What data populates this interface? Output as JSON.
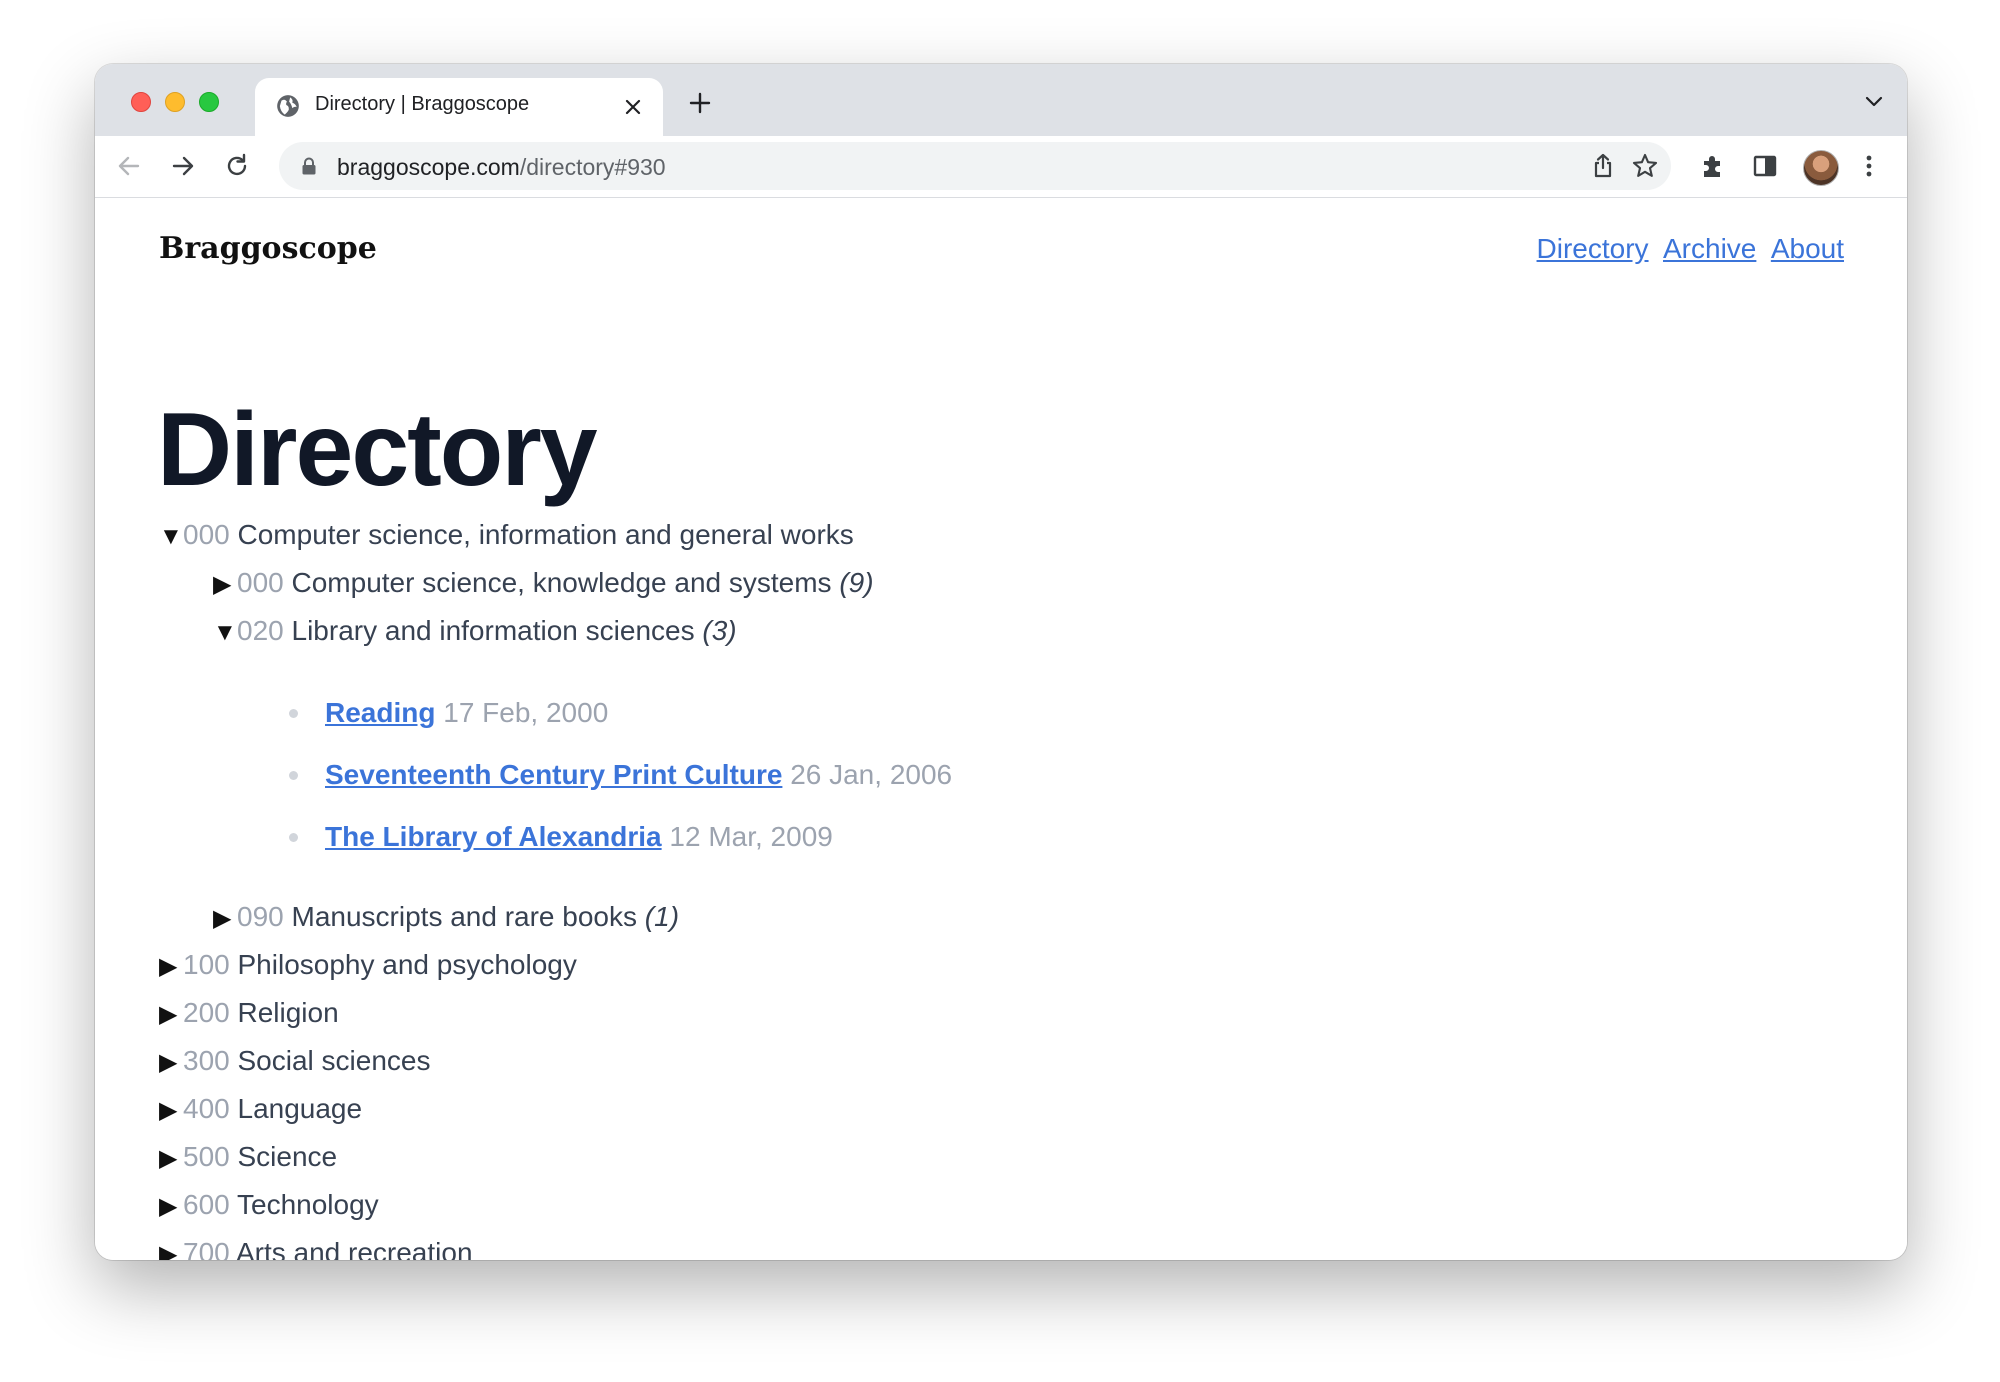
{
  "browser": {
    "tab_title": "Directory | Braggoscope",
    "url_host": "braggoscope.com",
    "url_path": "/directory#930"
  },
  "site": {
    "title": "Braggoscope",
    "nav": [
      "Directory",
      "Archive",
      "About"
    ]
  },
  "page": {
    "title": "Directory",
    "tree": [
      {
        "level": 0,
        "expanded": true,
        "code": "000",
        "label": "Computer science, information and general works",
        "count": ""
      },
      {
        "level": 1,
        "expanded": false,
        "code": "000",
        "label": "Computer science, knowledge and systems",
        "count": "(9)"
      },
      {
        "level": 1,
        "expanded": true,
        "code": "020",
        "label": "Library and information sciences",
        "count": "(3)",
        "episodes": [
          {
            "title": "Reading",
            "date": "17 Feb, 2000"
          },
          {
            "title": "Seventeenth Century Print Culture",
            "date": "26 Jan, 2006"
          },
          {
            "title": "The Library of Alexandria",
            "date": "12 Mar, 2009"
          }
        ]
      },
      {
        "level": 1,
        "expanded": false,
        "code": "090",
        "label": "Manuscripts and rare books",
        "count": "(1)"
      },
      {
        "level": 0,
        "expanded": false,
        "code": "100",
        "label": "Philosophy and psychology",
        "count": ""
      },
      {
        "level": 0,
        "expanded": false,
        "code": "200",
        "label": "Religion",
        "count": ""
      },
      {
        "level": 0,
        "expanded": false,
        "code": "300",
        "label": "Social sciences",
        "count": ""
      },
      {
        "level": 0,
        "expanded": false,
        "code": "400",
        "label": "Language",
        "count": ""
      },
      {
        "level": 0,
        "expanded": false,
        "code": "500",
        "label": "Science",
        "count": ""
      },
      {
        "level": 0,
        "expanded": false,
        "code": "600",
        "label": "Technology",
        "count": ""
      },
      {
        "level": 0,
        "expanded": false,
        "code": "700",
        "label": "Arts and recreation",
        "count": ""
      }
    ]
  },
  "colors": {
    "link": "#3b74d9",
    "code": "#9ca3af",
    "text": "#374151",
    "title": "#111827"
  },
  "icons": [
    "globe-icon",
    "close-icon",
    "plus-icon",
    "chevron-down-icon",
    "back-arrow-icon",
    "forward-arrow-icon",
    "reload-icon",
    "lock-icon",
    "share-icon",
    "star-icon",
    "puzzle-icon",
    "side-panel-icon",
    "avatar",
    "more-vert-icon",
    "triangle-down-icon",
    "triangle-right-icon"
  ]
}
